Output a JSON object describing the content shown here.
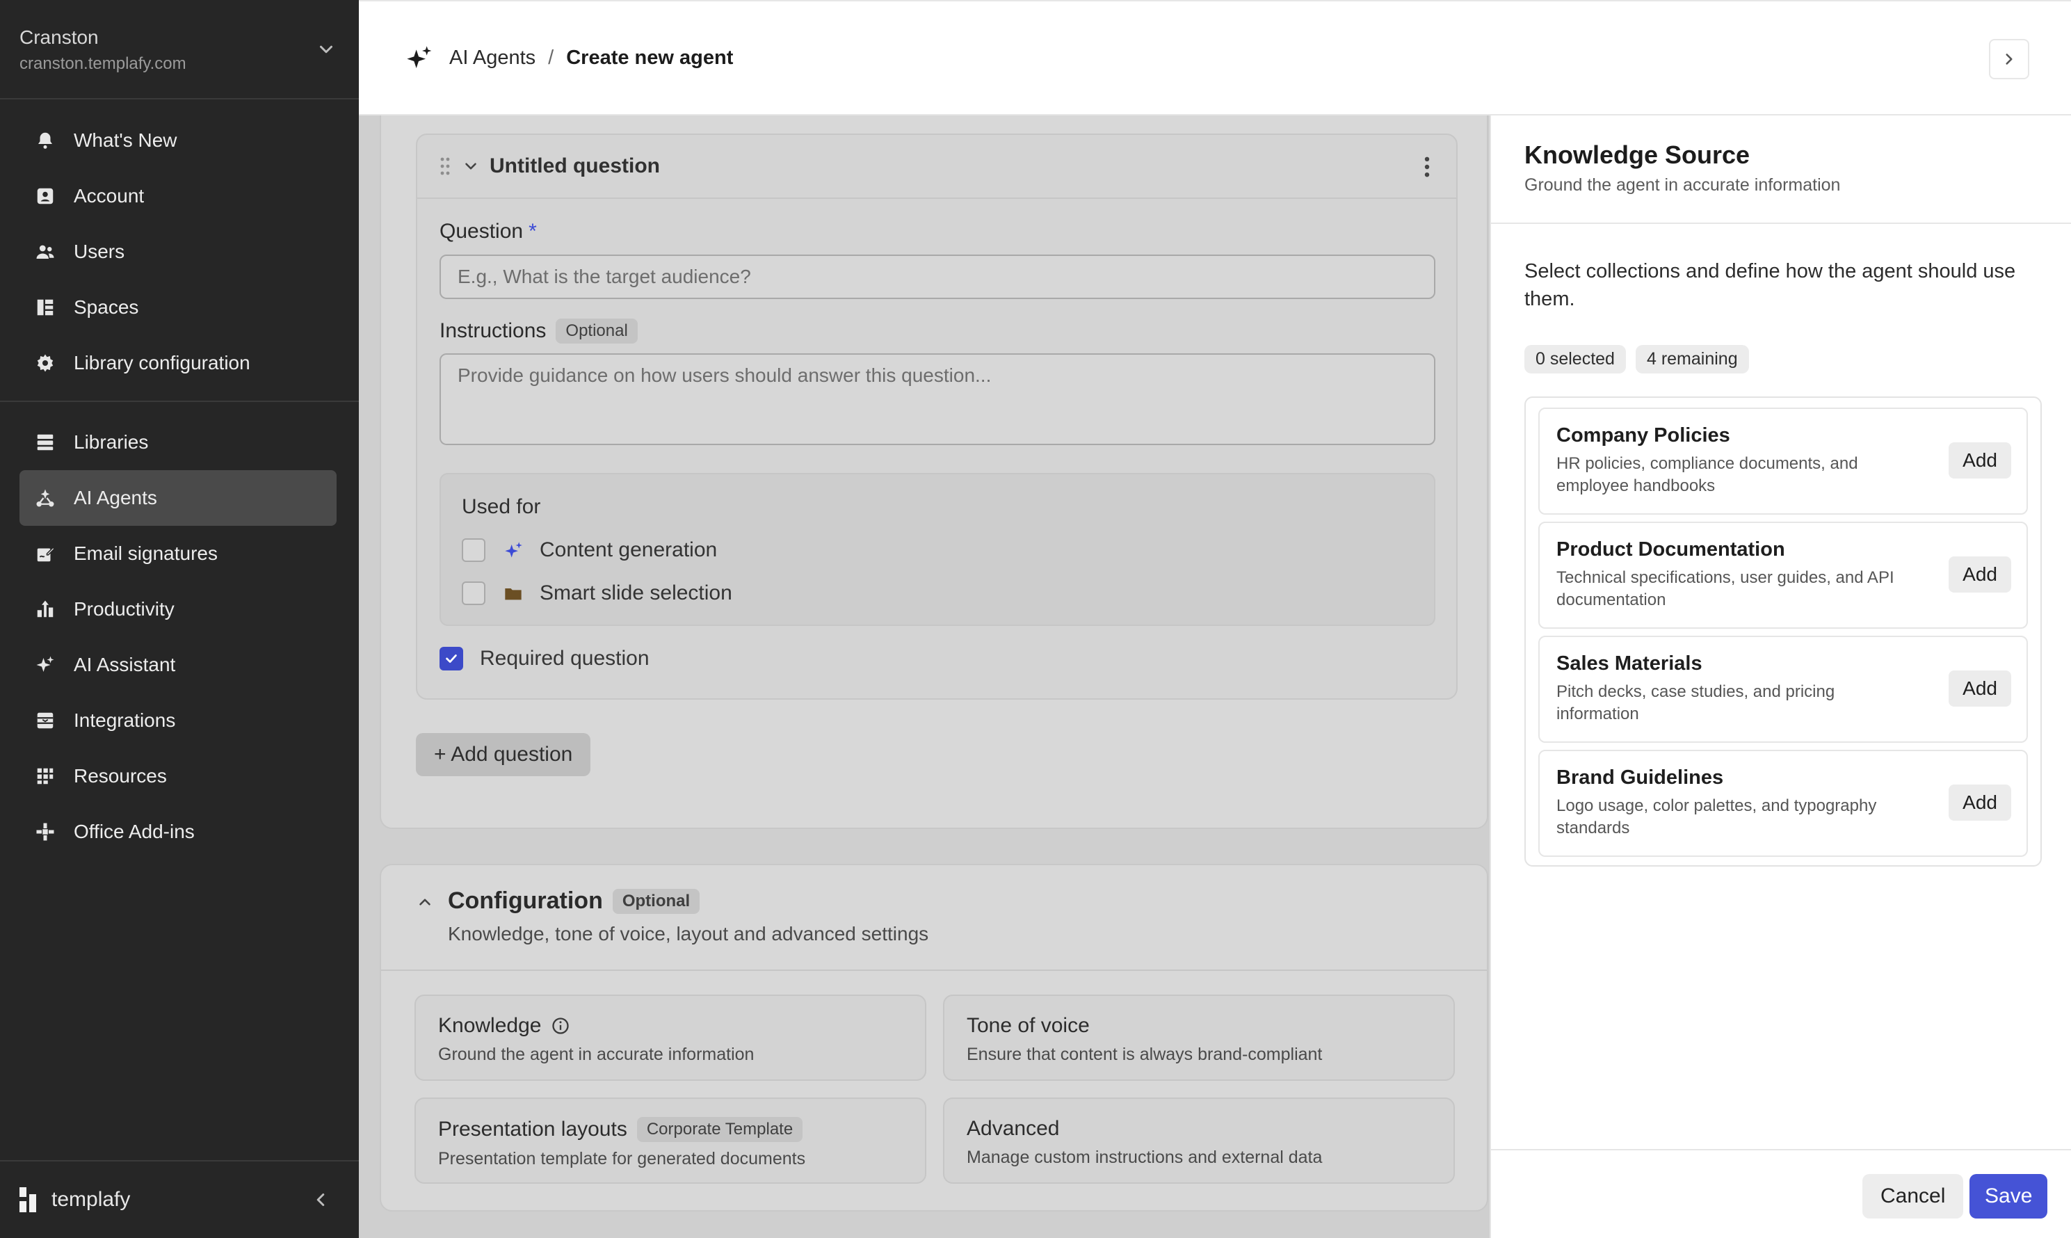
{
  "org": {
    "name": "Cranston",
    "domain": "cranston.templafy.com"
  },
  "nav": {
    "primary": [
      {
        "label": "What's New",
        "icon": "bell-icon"
      },
      {
        "label": "Account",
        "icon": "account-icon"
      },
      {
        "label": "Users",
        "icon": "users-icon"
      },
      {
        "label": "Spaces",
        "icon": "spaces-icon"
      },
      {
        "label": "Library configuration",
        "icon": "gear-icon"
      }
    ],
    "secondary": [
      {
        "label": "Libraries",
        "icon": "libraries-icon"
      },
      {
        "label": "AI Agents",
        "icon": "agents-icon",
        "active": true
      },
      {
        "label": "Email signatures",
        "icon": "signature-icon"
      },
      {
        "label": "Productivity",
        "icon": "productivity-icon"
      },
      {
        "label": "AI Assistant",
        "icon": "sparkle-icon"
      },
      {
        "label": "Integrations",
        "icon": "integrations-icon"
      },
      {
        "label": "Resources",
        "icon": "grid-icon"
      },
      {
        "label": "Office Add-ins",
        "icon": "addins-icon"
      }
    ]
  },
  "brand": {
    "name": "templafy"
  },
  "header": {
    "crumb_root": "AI Agents",
    "separator": "/",
    "crumb_current": "Create new agent"
  },
  "question": {
    "title": "Untitled question",
    "question_label": "Question",
    "required_mark": "*",
    "question_placeholder": "E.g., What is the target audience?",
    "instructions_label": "Instructions",
    "optional_label": "Optional",
    "instructions_placeholder": "Provide guidance on how users should answer this question...",
    "used_for_title": "Used for",
    "used_for": [
      {
        "label": "Content generation",
        "checked": false
      },
      {
        "label": "Smart slide selection",
        "checked": false
      }
    ],
    "required_label": "Required question",
    "required_checked": true
  },
  "add_question": "+ Add question",
  "configuration": {
    "title": "Configuration",
    "optional_label": "Optional",
    "subtitle": "Knowledge, tone of voice, layout and advanced settings",
    "cards": [
      {
        "title": "Knowledge",
        "subtitle": "Ground the agent in accurate information"
      },
      {
        "title": "Tone of voice",
        "subtitle": "Ensure that content is always brand-compliant"
      },
      {
        "title": "Presentation layouts",
        "badge": "Corporate Template",
        "subtitle": "Presentation template for generated documents"
      },
      {
        "title": "Advanced",
        "subtitle": "Manage custom instructions and external data"
      }
    ]
  },
  "panel": {
    "title": "Knowledge Source",
    "subtitle": "Ground the agent in accurate information",
    "description": "Select collections and define how the agent should use them.",
    "selected": "0 selected",
    "remaining": "4 remaining",
    "collections": [
      {
        "title": "Company Policies",
        "description": "HR policies, compliance documents, and employee handbooks",
        "action": "Add"
      },
      {
        "title": "Product Documentation",
        "description": "Technical specifications, user guides, and API documentation",
        "action": "Add"
      },
      {
        "title": "Sales Materials",
        "description": "Pitch decks, case studies, and pricing information",
        "action": "Add"
      },
      {
        "title": "Brand Guidelines",
        "description": "Logo usage, color palettes, and typography standards",
        "action": "Add"
      }
    ],
    "cancel": "Cancel",
    "save": "Save"
  },
  "colors": {
    "accent": "#4553d6",
    "sidebar_bg": "#262626",
    "active_item": "#4a4a4a"
  }
}
